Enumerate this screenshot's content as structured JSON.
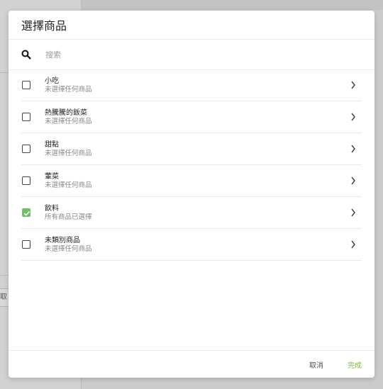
{
  "background": {
    "cancel_fragment": "取消"
  },
  "dialog": {
    "title": "選擇商品",
    "search": {
      "placeholder": "搜索",
      "value": ""
    },
    "items": [
      {
        "title": "小吃",
        "subtitle": "未選擇任何商品",
        "checked": false
      },
      {
        "title": "熱騰騰的飯菜",
        "subtitle": "未選擇任何商品",
        "checked": false
      },
      {
        "title": "甜點",
        "subtitle": "未選擇任何商品",
        "checked": false
      },
      {
        "title": "葷菜",
        "subtitle": "未選擇任何商品",
        "checked": false
      },
      {
        "title": "飲料",
        "subtitle": "所有商品已選擇",
        "checked": true
      },
      {
        "title": "未類別商品",
        "subtitle": "未選擇任何商品",
        "checked": false
      }
    ],
    "footer": {
      "cancel_label": "取消",
      "done_label": "完成"
    }
  },
  "colors": {
    "accent_green": "#70c163",
    "done_text": "#7bbf3a"
  },
  "icons": {
    "search": "search-icon",
    "chevron": "chevron-right-icon",
    "check": "checkmark-icon"
  }
}
